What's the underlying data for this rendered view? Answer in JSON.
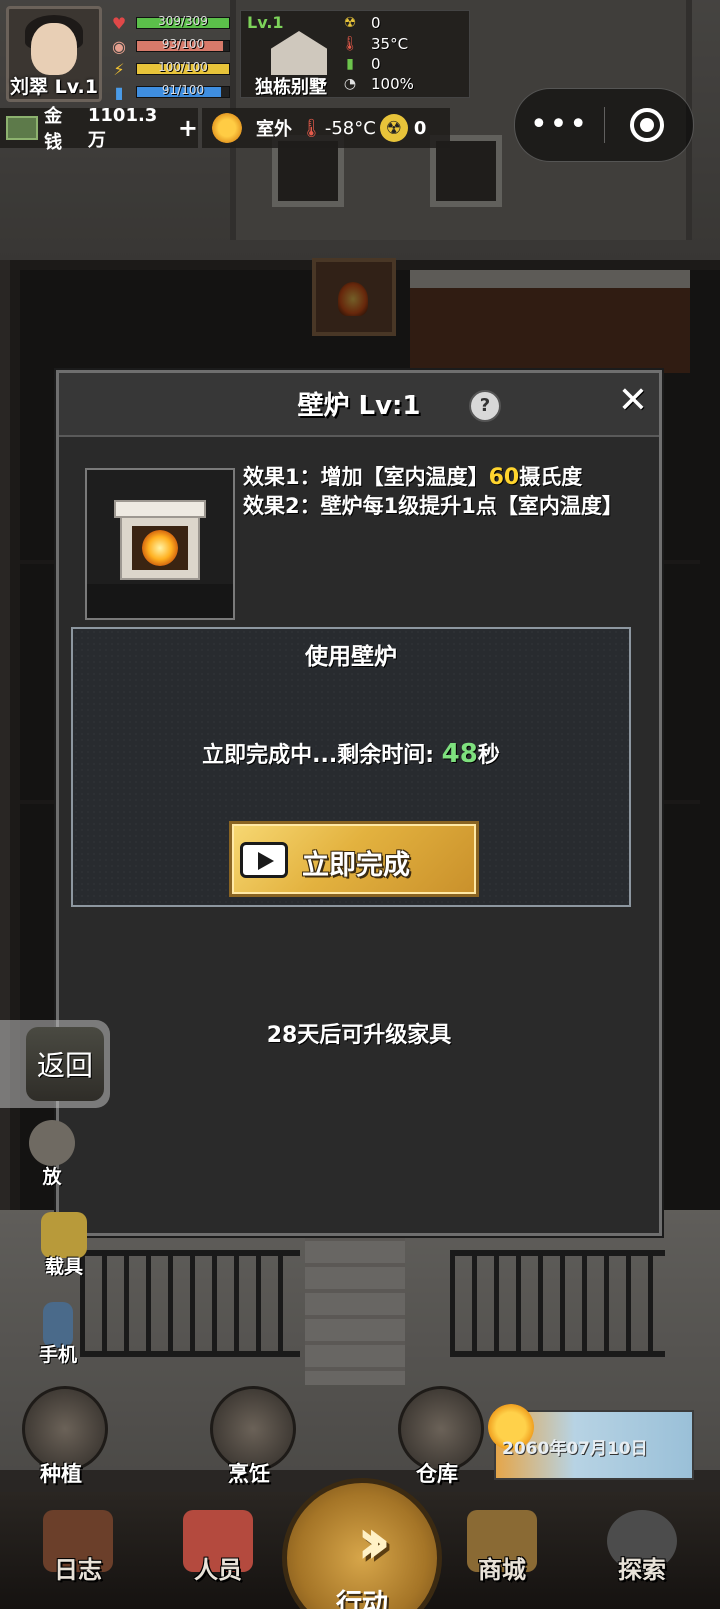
{
  "hud": {
    "player_name": "刘翠 Lv.1",
    "stats": [
      {
        "icon": "heart-icon",
        "text": "309/309",
        "percent": 100,
        "color": "#5bbf4a"
      },
      {
        "icon": "stomach-icon",
        "text": "93/100",
        "percent": 93,
        "color": "#d77a6a"
      },
      {
        "icon": "energy-icon",
        "text": "100/100",
        "percent": 100,
        "color": "#e8c43a"
      },
      {
        "icon": "water-icon",
        "text": "91/100",
        "percent": 91,
        "color": "#3f8ee0"
      }
    ],
    "house": {
      "level": "Lv.1",
      "name": "独栋别墅",
      "stats": [
        {
          "icon": "radiation-icon",
          "value": "0"
        },
        {
          "icon": "thermometer-icon",
          "value": "35°C"
        },
        {
          "icon": "battery-icon",
          "value": "0"
        },
        {
          "icon": "pie-icon",
          "value": "100%"
        }
      ]
    },
    "money": {
      "label": "金钱",
      "value": "1101.3万",
      "plus": "+"
    },
    "weather": {
      "label": "室外",
      "temperature": "-58°C",
      "radiation": "0"
    }
  },
  "capsule": {
    "more": "•••"
  },
  "dialog": {
    "title": "壁炉 Lv:1",
    "help": "?",
    "close": "✕",
    "effect1_prefix": "效果1：增加【室内温度】",
    "effect1_value": "60",
    "effect1_suffix": "摄氏度",
    "effect2": "效果2：壁炉每1级提升1点【室内温度】",
    "use_title": "使用壁炉",
    "status_prefix": "立即完成中...剩余时间: ",
    "status_seconds": "48",
    "status_unit": "秒",
    "finish_button": "立即完成",
    "upgrade_note": "28天后可升级家具"
  },
  "back_button": "返回",
  "side_menu": [
    {
      "label": "放"
    },
    {
      "label": "载具"
    },
    {
      "label": "手机"
    }
  ],
  "round_buttons": [
    {
      "label": "种植"
    },
    {
      "label": "烹饪"
    },
    {
      "label": "仓库"
    }
  ],
  "date": "2060年07月10日",
  "bottom_nav": [
    {
      "label": "日志"
    },
    {
      "label": "人员"
    },
    {
      "label": "行动"
    },
    {
      "label": "商城"
    },
    {
      "label": "探索"
    }
  ]
}
